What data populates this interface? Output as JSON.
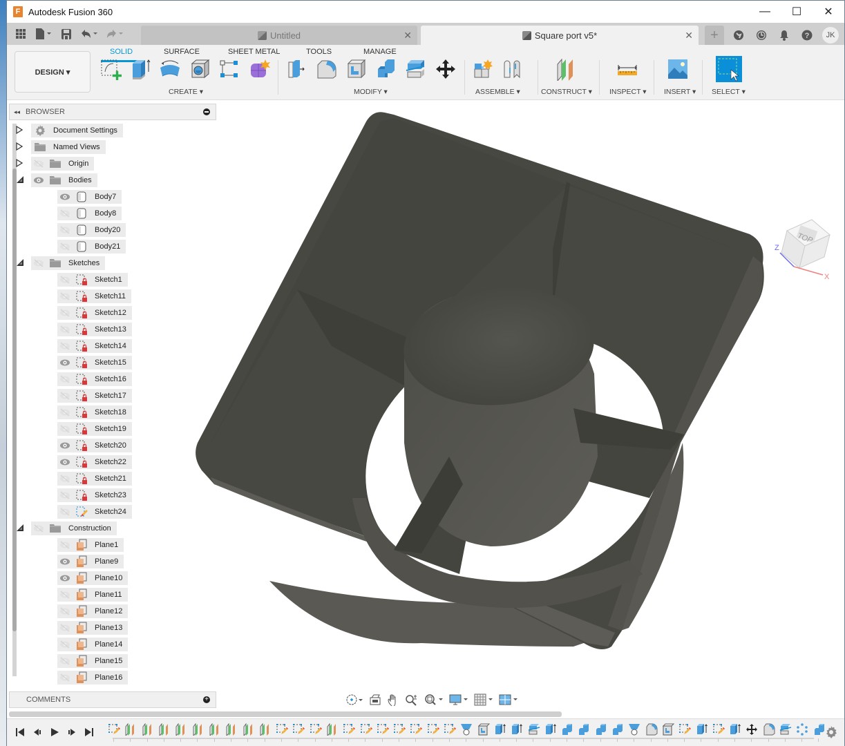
{
  "window": {
    "app_title": "Autodesk Fusion 360",
    "logo_letter": "F",
    "minimize": "—",
    "maximize": "☐",
    "close": "✕"
  },
  "quick_access": {
    "icons": [
      "grid-menu-icon",
      "file-icon",
      "save-icon",
      "undo-icon",
      "redo-icon"
    ]
  },
  "doc_tabs": [
    {
      "label": "Untitled",
      "active": false
    },
    {
      "label": "Square port v5*",
      "active": true
    }
  ],
  "top_right": {
    "new_tab": "+",
    "icons": [
      "extensions-icon",
      "job-status-icon",
      "notifications-icon",
      "help-icon"
    ],
    "avatar": "JK"
  },
  "ribbon": {
    "workspace": "DESIGN ▾",
    "tabs": [
      "SOLID",
      "SURFACE",
      "SHEET METAL",
      "TOOLS",
      "MANAGE"
    ],
    "active_tab": "SOLID",
    "groups": [
      {
        "label": "CREATE ▾",
        "tools": [
          "create-sketch",
          "extrude",
          "revolve",
          "hole",
          "pattern",
          "form"
        ]
      },
      {
        "label": "MODIFY ▾",
        "tools": [
          "press-pull",
          "fillet",
          "shell",
          "combine",
          "split-body",
          "move-copy"
        ]
      },
      {
        "label": "ASSEMBLE ▾",
        "tools": [
          "new-component",
          "joint"
        ]
      },
      {
        "label": "CONSTRUCT ▾",
        "tools": [
          "offset-plane"
        ]
      },
      {
        "label": "INSPECT ▾",
        "tools": [
          "measure"
        ]
      },
      {
        "label": "INSERT ▾",
        "tools": [
          "insert-image"
        ]
      },
      {
        "label": "SELECT ▾",
        "tools": [
          "select"
        ]
      }
    ]
  },
  "browser": {
    "title": "BROWSER",
    "collapse_icon": "◂◂",
    "top_nodes": [
      {
        "label": "Document Settings",
        "expanded": false,
        "icon": "gear",
        "eye": "none"
      },
      {
        "label": "Named Views",
        "expanded": false,
        "icon": "folder",
        "eye": "none"
      },
      {
        "label": "Origin",
        "expanded": false,
        "icon": "folder",
        "eye": "hidden"
      },
      {
        "label": "Bodies",
        "expanded": true,
        "icon": "folder",
        "eye": "visible"
      }
    ],
    "bodies": [
      {
        "label": "Body7",
        "visible": true
      },
      {
        "label": "Body8",
        "visible": false
      },
      {
        "label": "Body20",
        "visible": false
      },
      {
        "label": "Body21",
        "visible": false
      }
    ],
    "sketches_folder": {
      "label": "Sketches",
      "expanded": true,
      "eye": "hidden"
    },
    "sketches": [
      {
        "label": "Sketch1",
        "visible": false,
        "locked": true
      },
      {
        "label": "Sketch11",
        "visible": false,
        "locked": true
      },
      {
        "label": "Sketch12",
        "visible": false,
        "locked": true
      },
      {
        "label": "Sketch13",
        "visible": false,
        "locked": true
      },
      {
        "label": "Sketch14",
        "visible": false,
        "locked": true
      },
      {
        "label": "Sketch15",
        "visible": true,
        "locked": true
      },
      {
        "label": "Sketch16",
        "visible": false,
        "locked": true
      },
      {
        "label": "Sketch17",
        "visible": false,
        "locked": true
      },
      {
        "label": "Sketch18",
        "visible": false,
        "locked": true
      },
      {
        "label": "Sketch19",
        "visible": false,
        "locked": true
      },
      {
        "label": "Sketch20",
        "visible": true,
        "locked": true
      },
      {
        "label": "Sketch22",
        "visible": true,
        "locked": true
      },
      {
        "label": "Sketch21",
        "visible": false,
        "locked": true
      },
      {
        "label": "Sketch23",
        "visible": false,
        "locked": true
      },
      {
        "label": "Sketch24",
        "visible": false,
        "locked": false
      }
    ],
    "construction_folder": {
      "label": "Construction",
      "expanded": true,
      "eye": "hidden"
    },
    "planes": [
      {
        "label": "Plane1",
        "visible": false
      },
      {
        "label": "Plane9",
        "visible": true
      },
      {
        "label": "Plane10",
        "visible": true
      },
      {
        "label": "Plane11",
        "visible": false
      },
      {
        "label": "Plane12",
        "visible": false
      },
      {
        "label": "Plane13",
        "visible": false
      },
      {
        "label": "Plane14",
        "visible": false
      },
      {
        "label": "Plane15",
        "visible": false
      },
      {
        "label": "Plane16",
        "visible": false
      }
    ]
  },
  "comments": {
    "title": "COMMENTS"
  },
  "viewcube": {
    "face": "TOP",
    "axis_x": "X",
    "axis_z": "Z"
  },
  "nav_bar": {
    "icons": [
      "orbit-icon",
      "look-at-icon",
      "pan-icon",
      "zoom-icon",
      "fit-icon",
      "display-settings-icon",
      "grid-settings-icon",
      "viewports-icon"
    ]
  },
  "timeline": {
    "controls": [
      "first",
      "previous",
      "play",
      "next",
      "last"
    ],
    "features": [
      "sketch",
      "plane",
      "plane",
      "plane",
      "plane",
      "plane",
      "plane",
      "plane",
      "plane",
      "plane",
      "sketch",
      "sketch",
      "sketch",
      "plane",
      "sketch",
      "sketch",
      "sketch",
      "sketch",
      "sketch",
      "sketch",
      "sketch",
      "loft",
      "shell",
      "extrude",
      "extrude",
      "split",
      "extrude",
      "combine",
      "combine",
      "combine",
      "combine",
      "loft",
      "fillet",
      "shell",
      "sketch",
      "extrude",
      "sketch",
      "extrude",
      "move",
      "fillet",
      "split",
      "pattern",
      "combine"
    ]
  },
  "colors": {
    "accent": "#0696d7",
    "model": "#4a4a45",
    "plane_green": "#5cbf6a",
    "plane_orange": "#e0915a",
    "sketch_lock": "#d9383a"
  }
}
